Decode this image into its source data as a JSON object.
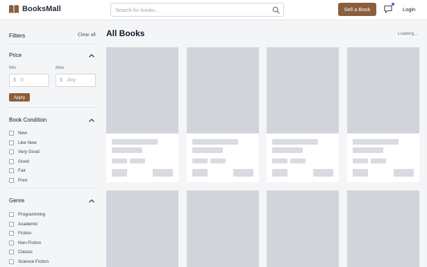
{
  "header": {
    "logo_text": "BooksMall",
    "search_placeholder": "Search for books...",
    "sell_label": "Sell a Book",
    "login_label": "Login"
  },
  "sidebar": {
    "title": "Filters",
    "clear_label": "Clear all",
    "price": {
      "title": "Price",
      "min_label": "Min",
      "max_label": "Max",
      "currency": "$",
      "min_placeholder": "0",
      "max_placeholder": "Any",
      "apply_label": "Apply"
    },
    "condition": {
      "title": "Book Condition",
      "options": [
        "New",
        "Like New",
        "Very Good",
        "Good",
        "Fair",
        "Poor"
      ]
    },
    "genre": {
      "title": "Genre",
      "options": [
        "Programming",
        "Academic",
        "Fiction",
        "Non-Fiction",
        "Classic",
        "Science Fiction"
      ]
    }
  },
  "main": {
    "title": "All Books",
    "status": "Loading..."
  },
  "colors": {
    "accent": "#8b5e3c",
    "notification_dot": "#7c3aed",
    "skeleton": "#d1d5db"
  }
}
